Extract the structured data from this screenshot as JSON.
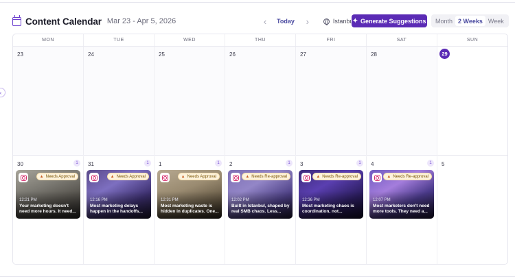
{
  "header": {
    "title": "Content Calendar",
    "range": "Mar 23 - Apr 5, 2026",
    "today_label": "Today",
    "timezone": "Istanbul",
    "generate_label": "Generate Suggestions",
    "views": [
      "Month",
      "2 Weeks",
      "Week"
    ],
    "active_view": "2 Weeks",
    "accent_color": "#5b2bb5"
  },
  "weekdays": [
    "MON",
    "TUE",
    "WED",
    "THU",
    "FRI",
    "SAT",
    "SUN"
  ],
  "week1": [
    {
      "day": "23"
    },
    {
      "day": "24"
    },
    {
      "day": "25"
    },
    {
      "day": "26"
    },
    {
      "day": "27"
    },
    {
      "day": "28"
    },
    {
      "day": "29",
      "today": true
    }
  ],
  "week2": [
    {
      "day": "30",
      "count": "1",
      "post": {
        "status": "Needs Approval",
        "time": "12:21 PM",
        "caption": "Your marketing doesn't need more hours. It need..."
      }
    },
    {
      "day": "31",
      "count": "1",
      "post": {
        "status": "Needs Approval",
        "time": "12:16 PM",
        "caption": "Most marketing delays happen in the handoffs..."
      }
    },
    {
      "day": "1",
      "count": "1",
      "post": {
        "status": "Needs Approval",
        "time": "12:31 PM",
        "caption": "Most marketing waste is hidden in duplicates. One..."
      }
    },
    {
      "day": "2",
      "count": "1",
      "post": {
        "status": "Needs Re-approval",
        "time": "12:02 PM",
        "caption": "Built in Istanbul, shaped by real SMB chaos. Less..."
      }
    },
    {
      "day": "3",
      "count": "1",
      "post": {
        "status": "Needs Re-approval",
        "time": "12:36 PM",
        "caption": "Most marketing chaos is coordination, not..."
      }
    },
    {
      "day": "4",
      "count": "1",
      "post": {
        "status": "Needs Re-approval",
        "time": "12:07 PM",
        "caption": "Most marketers don't need more tools. They need a..."
      }
    },
    {
      "day": "5"
    }
  ]
}
